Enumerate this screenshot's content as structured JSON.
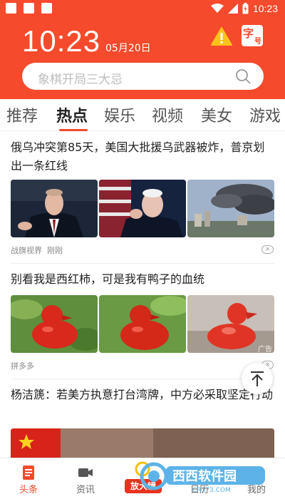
{
  "status_bar": {
    "time": "10:23"
  },
  "header": {
    "clock": "10:23",
    "date": "05月20日",
    "font_badge": {
      "char1": "字",
      "char2": "号"
    },
    "search": {
      "placeholder": "象棋开局三大忌"
    }
  },
  "tabs": [
    {
      "label": "推荐",
      "active": false
    },
    {
      "label": "热点",
      "active": true
    },
    {
      "label": "娱乐",
      "active": false
    },
    {
      "label": "视频",
      "active": false
    },
    {
      "label": "美女",
      "active": false
    },
    {
      "label": "游戏",
      "active": false
    }
  ],
  "feed": [
    {
      "title": "俄乌冲突第85天，美国大批援乌武器被炸，普京划出一条红线",
      "source": "战旗视界",
      "time": "刚刚"
    },
    {
      "title": "别看我是西红柿，可是我有鸭子的血统",
      "source": "拼多多",
      "ad_tag": "广告"
    },
    {
      "title": "杨洁篪：若美方执意打台湾牌，中方必采取坚定行动"
    }
  ],
  "bottom_nav": [
    {
      "label": "头条",
      "icon": "news-icon",
      "active": true
    },
    {
      "label": "资讯",
      "icon": "video-icon",
      "active": false
    },
    {
      "label": "放大镜",
      "icon": "magnifier-icon",
      "active": false
    },
    {
      "label": "日历",
      "icon": "calendar-icon",
      "active": false
    },
    {
      "label": "我的",
      "icon": "user-icon",
      "active": false
    }
  ],
  "watermark": {
    "text": "西西软件园",
    "domain": "CR173.COM"
  },
  "colors": {
    "brand": "#f54a2c",
    "active_tab_underline": "#f54a2c"
  }
}
